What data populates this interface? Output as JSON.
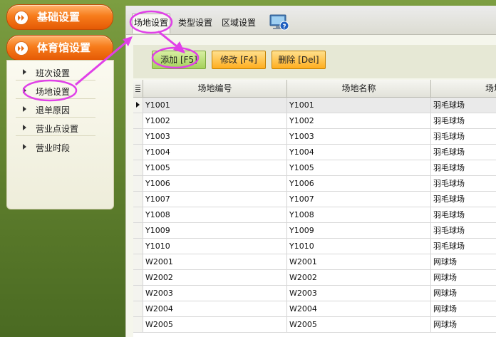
{
  "sidebar": {
    "categories": [
      {
        "label": "基础设置"
      },
      {
        "label": "体育馆设置"
      }
    ],
    "items": [
      {
        "label": "班次设置"
      },
      {
        "label": "场地设置"
      },
      {
        "label": "退单原因"
      },
      {
        "label": "营业点设置"
      },
      {
        "label": "营业时段"
      }
    ]
  },
  "tabs": [
    {
      "label": "场地设置",
      "active": true
    },
    {
      "label": "类型设置"
    },
    {
      "label": "区域设置"
    }
  ],
  "help_icon": "monitor-help-icon",
  "toolbar": {
    "add": "添加 [F5]",
    "edit": "修改 [F4]",
    "delete": "删除 [Del]"
  },
  "grid": {
    "columns": [
      "场地编号",
      "场地名称",
      "场地"
    ],
    "rows": [
      [
        "Y1001",
        "Y1001",
        "羽毛球场"
      ],
      [
        "Y1002",
        "Y1002",
        "羽毛球场"
      ],
      [
        "Y1003",
        "Y1003",
        "羽毛球场"
      ],
      [
        "Y1004",
        "Y1004",
        "羽毛球场"
      ],
      [
        "Y1005",
        "Y1005",
        "羽毛球场"
      ],
      [
        "Y1006",
        "Y1006",
        "羽毛球场"
      ],
      [
        "Y1007",
        "Y1007",
        "羽毛球场"
      ],
      [
        "Y1008",
        "Y1008",
        "羽毛球场"
      ],
      [
        "Y1009",
        "Y1009",
        "羽毛球场"
      ],
      [
        "Y1010",
        "Y1010",
        "羽毛球场"
      ],
      [
        "W2001",
        "W2001",
        "网球场"
      ],
      [
        "W2002",
        "W2002",
        "网球场"
      ],
      [
        "W2003",
        "W2003",
        "网球场"
      ],
      [
        "W2004",
        "W2004",
        "网球场"
      ],
      [
        "W2005",
        "W2005",
        "网球场"
      ]
    ]
  },
  "colors": {
    "accent_orange": "#f77c1b",
    "annotation": "#e040e8",
    "background_green": "#6b8d35"
  }
}
